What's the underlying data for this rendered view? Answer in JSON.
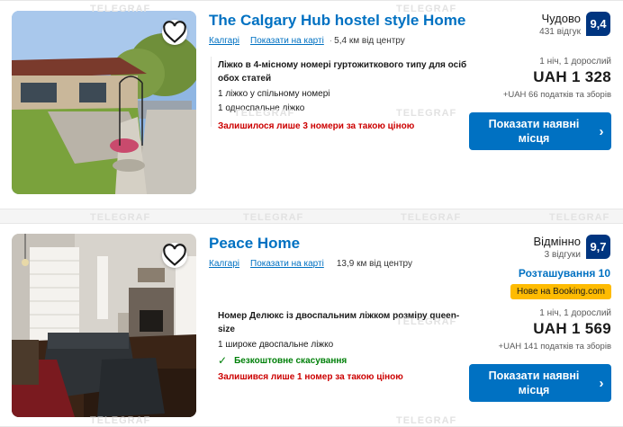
{
  "watermark": "TELEGRAF",
  "listings": [
    {
      "title": "The Calgary Hub hostel style Home",
      "city": "Калгарі",
      "map_link": "Показати на карті",
      "distance": "5,4 км від центру",
      "room_name": "Ліжко в 4-місному номері гуртожиткового типу для осіб обох статей",
      "room_lines": [
        "1 ліжко у спільному номері",
        "1 односпальне ліжко"
      ],
      "warning": "Залишилося лише 3 номери за такою ціною",
      "rating_word": "Чудово",
      "reviews": "431 відгук",
      "score": "9,4",
      "nights": "1 ніч, 1 дорослий",
      "price": "UAH 1 328",
      "taxes": "+UAH 66 податків та зборів",
      "cta": "Показати наявні місця"
    },
    {
      "title": "Peace Home",
      "city": "Калгарі",
      "map_link": "Показати на карті",
      "distance": "13,9 км від центру",
      "room_name": "Номер Делюкс із двоспальним ліжком розміру queen-size",
      "room_lines": [
        "1 широке двоспальне ліжко"
      ],
      "free_cancel": "Безкоштовне скасування",
      "warning": "Залишився лише 1 номер за такою ціною",
      "rating_word": "Відмінно",
      "reviews": "3 відгуки",
      "score": "9,7",
      "location_score": "Розташування 10",
      "new_badge": "Нове на Booking.com",
      "nights": "1 ніч, 1 дорослий",
      "price": "UAH 1 569",
      "taxes": "+UAH 141 податків та зборів",
      "cta": "Показати наявні місця"
    }
  ],
  "colors": {
    "link": "#0071c2",
    "score_bg": "#003580",
    "warning": "#cc0000",
    "free": "#008009",
    "badge": "#febb02"
  }
}
